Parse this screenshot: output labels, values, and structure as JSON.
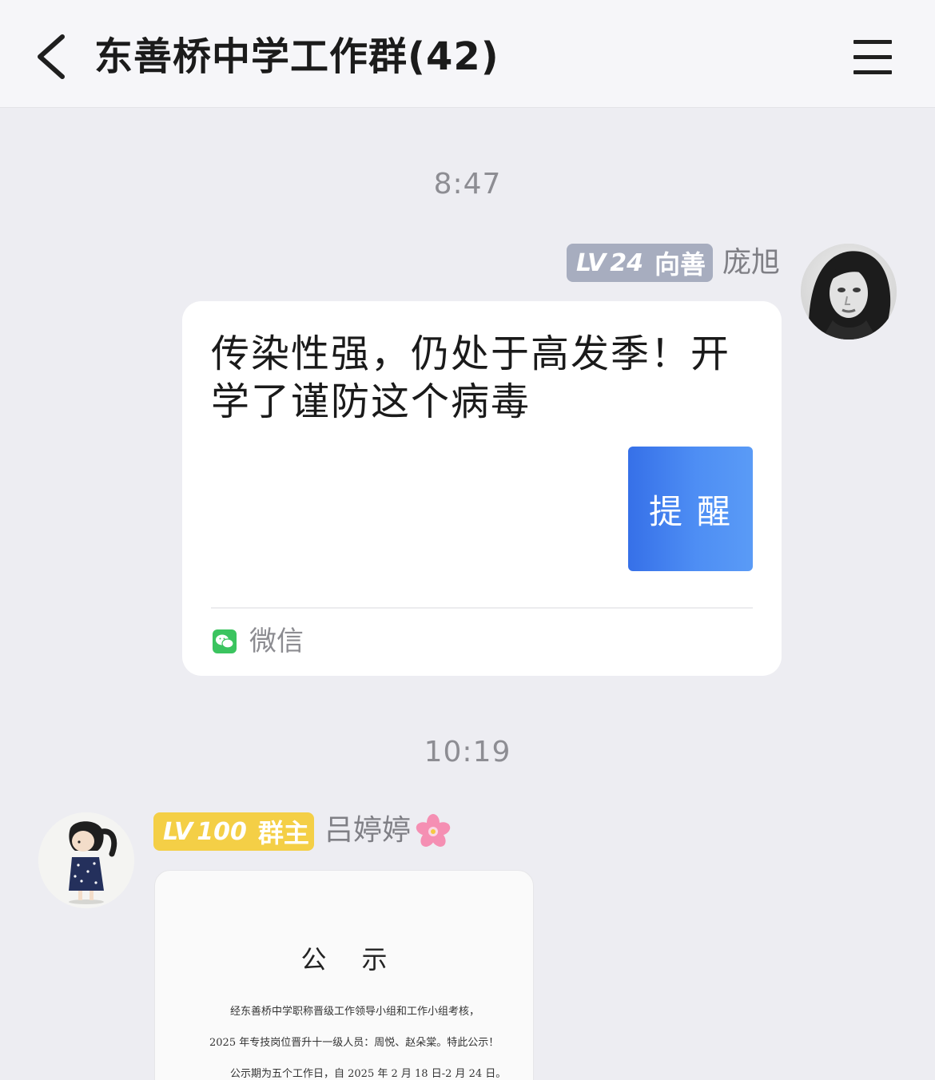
{
  "header": {
    "title": "东善桥中学工作群(42)"
  },
  "messages": [
    {
      "time": "8:47",
      "sender": {
        "level_prefix": "LV",
        "level": "24",
        "title": "向善",
        "name": "庞旭"
      },
      "card": {
        "text": "传染性强，仍处于高发季！开学了谨防这个病毒",
        "thumb_text": "提醒",
        "source": "微信"
      }
    },
    {
      "time": "10:19",
      "sender": {
        "level_prefix": "LV",
        "level": "100",
        "title": "群主",
        "name": "吕婷婷"
      },
      "document": {
        "title": "公示",
        "lines": [
          "经东善桥中学职称晋级工作领导小组和工作小组考核，",
          "2025 年专技岗位晋升十一级人员：周悦、赵朵棠。特此公示！",
          "公示期为五个工作日，自 2025 年 2 月 18 日-2 月 24 日。"
        ]
      }
    }
  ],
  "icons": {
    "back": "chevron-left-icon",
    "menu": "hamburger-menu-icon",
    "source": "wechat-icon",
    "emoji": "cherry-blossom-icon"
  },
  "colors": {
    "background": "#ededf2",
    "header_bg": "#f6f6f9",
    "badge_gray": "#a7adbf",
    "badge_gold": "#f4cf46",
    "thumb_blue": "#3670e8",
    "wechat_green": "#3bc45f"
  }
}
